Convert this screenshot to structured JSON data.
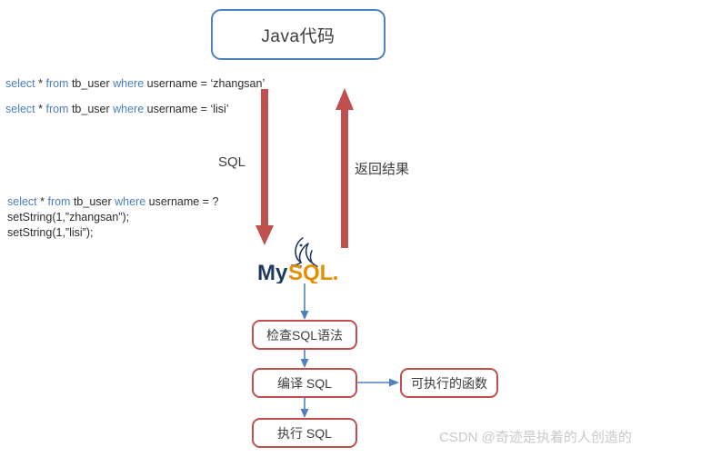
{
  "diagram": {
    "title_box": {
      "label": "Java代码",
      "border_color": "#4f81bd"
    },
    "code_blocks": [
      {
        "id": "code-1",
        "segments": [
          {
            "text": "select",
            "kw": true
          },
          {
            "text": " * ",
            "kw": false
          },
          {
            "text": "from",
            "kw": true
          },
          {
            "text": " tb_user ",
            "kw": false
          },
          {
            "text": "where",
            "kw": true
          },
          {
            "text": " username = ‘zhangsan’",
            "kw": false
          }
        ],
        "plain": "select * from tb_user where username = ‘zhangsan’"
      },
      {
        "id": "code-2",
        "segments": [
          {
            "text": "select",
            "kw": true
          },
          {
            "text": " * ",
            "kw": false
          },
          {
            "text": "from",
            "kw": true
          },
          {
            "text": " tb_user ",
            "kw": false
          },
          {
            "text": "where",
            "kw": true
          },
          {
            "text": " username = ‘lisi’",
            "kw": false
          }
        ],
        "plain": "select * from tb_user where username = ‘lisi’"
      }
    ],
    "prepared_block": {
      "line1_segments": [
        {
          "text": "select",
          "kw": true
        },
        {
          "text": " * ",
          "kw": false
        },
        {
          "text": "from",
          "kw": true
        },
        {
          "text": " tb_user ",
          "kw": false
        },
        {
          "text": "where",
          "kw": true
        },
        {
          "text": " username = ?",
          "kw": false
        }
      ],
      "line1_plain": "select * from tb_user where username = ?",
      "line2": "setString(1,”zhangsan”);",
      "line3": "setString(1,”lisi”);"
    },
    "arrows": {
      "down_label": "SQL",
      "up_label": "返回结果",
      "color": "#c0504d"
    },
    "mysql_logo": {
      "text_my": "My",
      "text_sql": "SQL",
      "color_my": "#1f3a5f",
      "color_sql": "#e48e00"
    },
    "flow_boxes": [
      {
        "id": "box-check",
        "label": "检查SQL语法"
      },
      {
        "id": "box-compile",
        "label": "编译 SQL"
      },
      {
        "id": "box-exec",
        "label": "执行 SQL"
      },
      {
        "id": "box-func",
        "label": "可执行的函数"
      }
    ],
    "flow_box_border_color": "#c0504d",
    "connector_color": "#4f81bd",
    "watermark": "CSDN @奇迹是执着的人创造的"
  }
}
